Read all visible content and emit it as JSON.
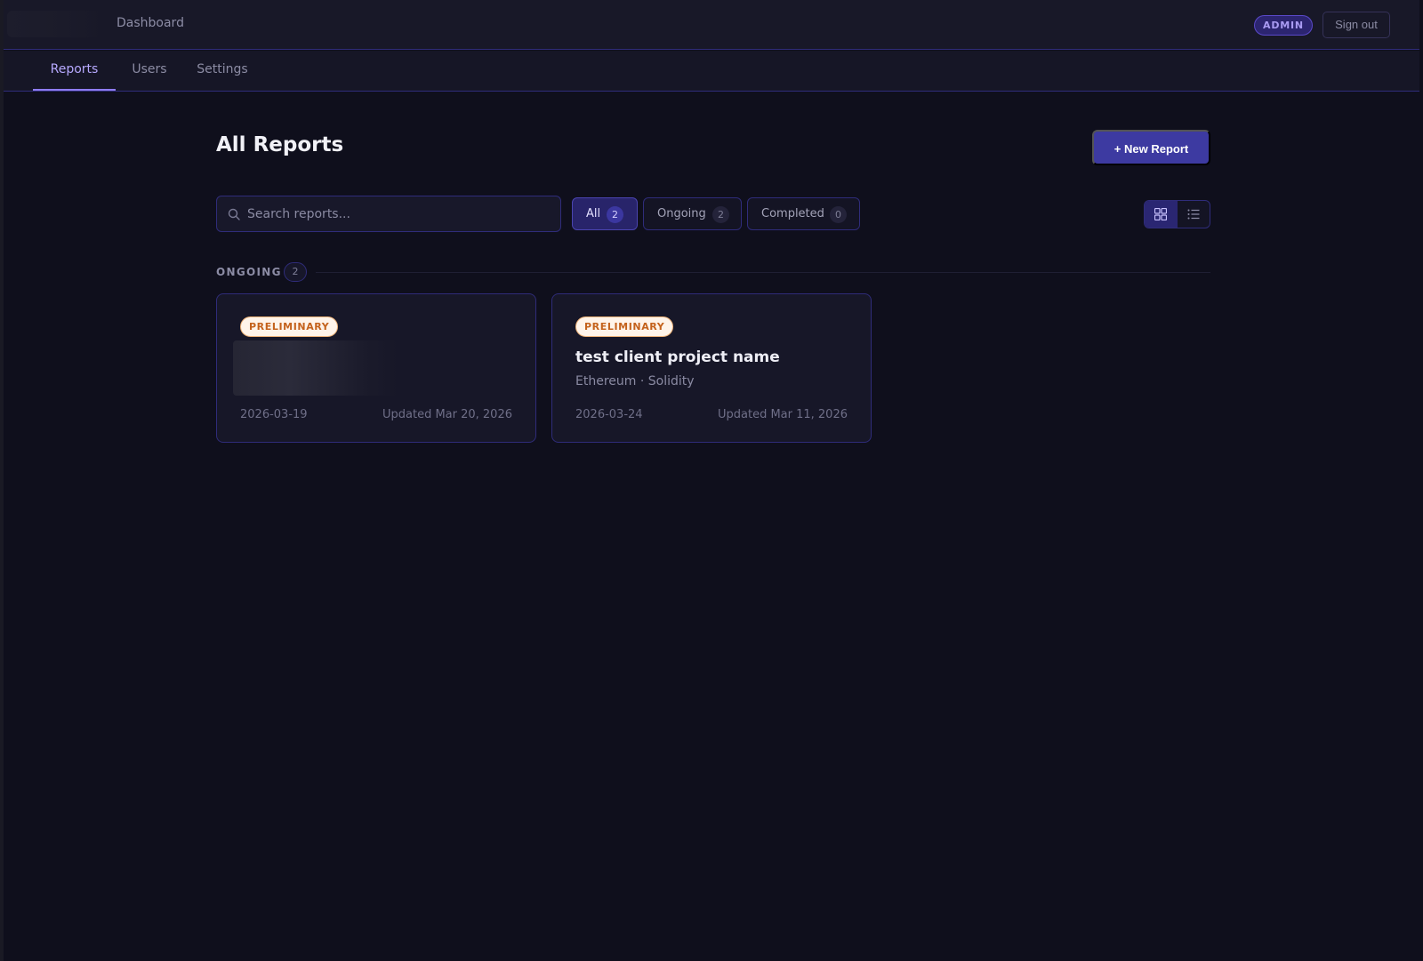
{
  "header": {
    "subtitle": "Dashboard",
    "role_badge": "ADMIN",
    "sign_out_label": "Sign out"
  },
  "tabs": [
    {
      "label": "Reports",
      "active": true
    },
    {
      "label": "Users",
      "active": false
    },
    {
      "label": "Settings",
      "active": false
    }
  ],
  "main": {
    "title": "All Reports",
    "new_report_label": "+ New Report",
    "search": {
      "placeholder": "Search reports...",
      "value": ""
    },
    "filters": [
      {
        "label": "All",
        "count": "2",
        "active": true
      },
      {
        "label": "Ongoing",
        "count": "2",
        "active": false
      },
      {
        "label": "Completed",
        "count": "0",
        "active": false
      }
    ],
    "view_mode": {
      "selected": "grid",
      "options": [
        "grid-icon",
        "list-icon"
      ]
    }
  },
  "sections": [
    {
      "label": "ONGOING",
      "count": "2",
      "cards": [
        {
          "badge": "PRELIMINARY",
          "title": "",
          "subtitle": "",
          "redacted": true,
          "date": "2026-03-19",
          "updated": "Updated Mar 20, 2026"
        },
        {
          "badge": "PRELIMINARY",
          "title": "test client project name",
          "subtitle": "Ethereum · Solidity",
          "redacted": false,
          "date": "2026-03-24",
          "updated": "Updated Mar 11, 2026"
        }
      ]
    }
  ],
  "colors": {
    "background": "#0f0f1c",
    "accent": "#3d3aa1",
    "tab_active": "#b7a9ff",
    "badge_preliminary": "#c4621c"
  }
}
